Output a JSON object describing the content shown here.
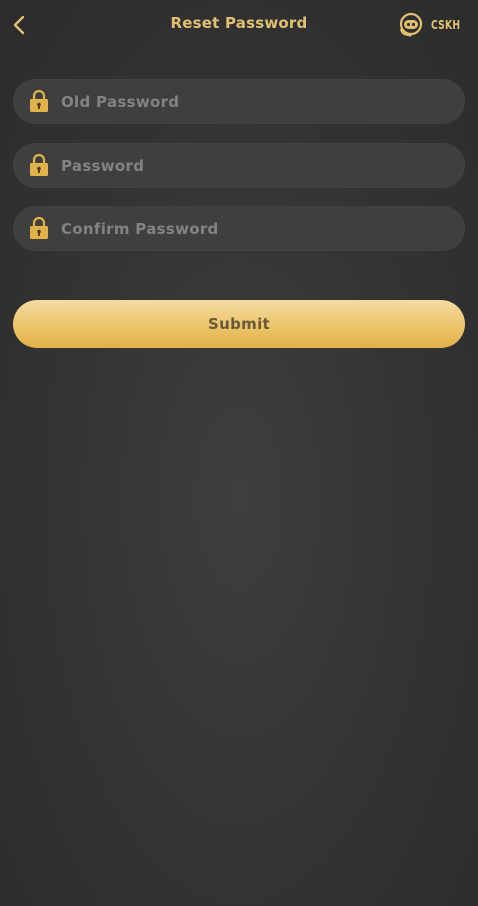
{
  "header": {
    "title": "Reset Password",
    "back_icon": "chevron-left-icon",
    "support_label": "CSKH",
    "support_icon": "headset-bot-icon"
  },
  "form": {
    "old_password": {
      "placeholder": "Old Password",
      "value": ""
    },
    "new_password": {
      "placeholder": "Password",
      "value": ""
    },
    "confirm_password": {
      "placeholder": "Confirm Password",
      "value": ""
    },
    "field_icon": "lock-icon",
    "submit_label": "Submit"
  },
  "colors": {
    "accent": "#e2c071",
    "background": "#333333",
    "field_bg": "#3f3f3f",
    "button_gradient_top": "#f4dba0",
    "button_gradient_bottom": "#e2b24a",
    "button_text": "#6a5a3a"
  }
}
